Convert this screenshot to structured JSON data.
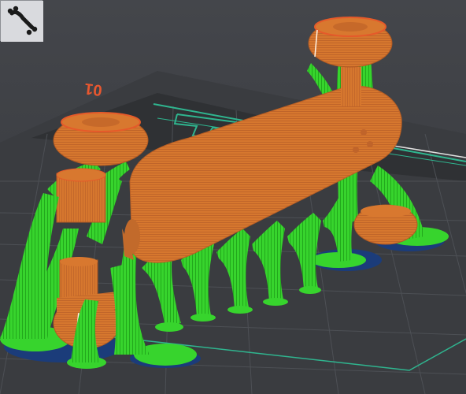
{
  "app": {
    "view": "3d-preview"
  },
  "thumbnail": {
    "icon": "object-thumbnail-icon",
    "selected": true
  },
  "build_plate": {
    "label": "01",
    "label_color": "#e8572f",
    "outline_color": "#2fb58f"
  },
  "model": {
    "color": "#d9772f",
    "support_color": "#33d62a",
    "raft_color": "#1b3c7a"
  }
}
